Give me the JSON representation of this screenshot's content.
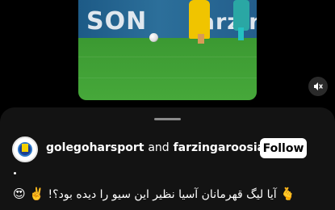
{
  "video": {
    "ad_left_text": "SON",
    "ad_right_text": "farzin"
  },
  "post": {
    "author": "golegoharsport",
    "and_text": "and",
    "coauthor": "farzingaroosian",
    "follow_label": "Follow",
    "caption_dot": ".",
    "caption_text": "آیا لیگ قهرمانان آسیا نظیر این سیو را دیده بود؟!",
    "emojis_left": "😍 ✌️",
    "emoji_right": "🫰"
  },
  "colors": {
    "background": "#000000",
    "sheet": "#131313",
    "follow_bg": "#ffffff",
    "follow_text": "#000000"
  },
  "icons": {
    "mute": "speaker-muted-icon",
    "avatar": "club-logo-icon"
  }
}
